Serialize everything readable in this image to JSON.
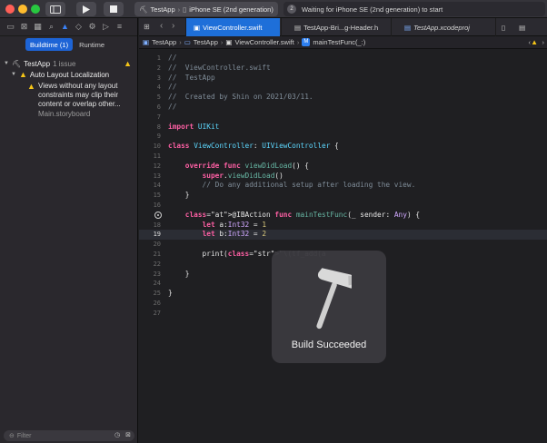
{
  "toolbar": {
    "scheme_project": "TestApp",
    "scheme_device": "iPhone SE (2nd generation)",
    "activity_text": "Waiting for iPhone SE (2nd generation) to start",
    "activity_badge": "2"
  },
  "navigator": {
    "segments": [
      "Buildtime (1)",
      "Runtime"
    ],
    "project": "TestApp",
    "project_issues": "1 issue",
    "group": "Auto Layout Localization",
    "warning_lines": [
      "Views without any layout",
      "constraints may clip their",
      "content or overlap other..."
    ],
    "warning_file": "Main.storyboard",
    "filter_placeholder": "Filter"
  },
  "editor": {
    "tabs": [
      "ViewController.swift",
      "TestApp-Bri...g-Header.h",
      "TestApp.xcodeproj"
    ],
    "jumpbar": [
      "TestApp",
      "TestApp",
      "ViewController.swift",
      "mainTestFunc(_:)"
    ],
    "hud_label": "Build Succeeded"
  },
  "code_lines": [
    {
      "n": "1",
      "t": "//"
    },
    {
      "n": "2",
      "t": "//  ViewController.swift"
    },
    {
      "n": "3",
      "t": "//  TestApp"
    },
    {
      "n": "4",
      "t": "//"
    },
    {
      "n": "5",
      "t": "//  Created by Shin on 2021/03/11."
    },
    {
      "n": "6",
      "t": "//"
    },
    {
      "n": "7",
      "t": ""
    },
    {
      "n": "8",
      "t": "import UIKit"
    },
    {
      "n": "9",
      "t": ""
    },
    {
      "n": "10",
      "t": "class ViewController: UIViewController {"
    },
    {
      "n": "11",
      "t": ""
    },
    {
      "n": "12",
      "t": "    override func viewDidLoad() {"
    },
    {
      "n": "13",
      "t": "        super.viewDidLoad()"
    },
    {
      "n": "14",
      "t": "        // Do any additional setup after loading the view."
    },
    {
      "n": "15",
      "t": "    }"
    },
    {
      "n": "16",
      "t": ""
    },
    {
      "n": "17",
      "t": "    @IBAction func mainTestFunc(_ sender: Any) {"
    },
    {
      "n": "18",
      "t": "        let a:Int32 = 1"
    },
    {
      "n": "19",
      "t": "        let b:Int32 = 2"
    },
    {
      "n": "20",
      "t": ""
    },
    {
      "n": "21",
      "t": "        print(\"\\(tf_add(a"
    },
    {
      "n": "22",
      "t": ""
    },
    {
      "n": "23",
      "t": "    }"
    },
    {
      "n": "24",
      "t": ""
    },
    {
      "n": "25",
      "t": "}"
    },
    {
      "n": "26",
      "t": ""
    },
    {
      "n": "27",
      "t": ""
    }
  ]
}
